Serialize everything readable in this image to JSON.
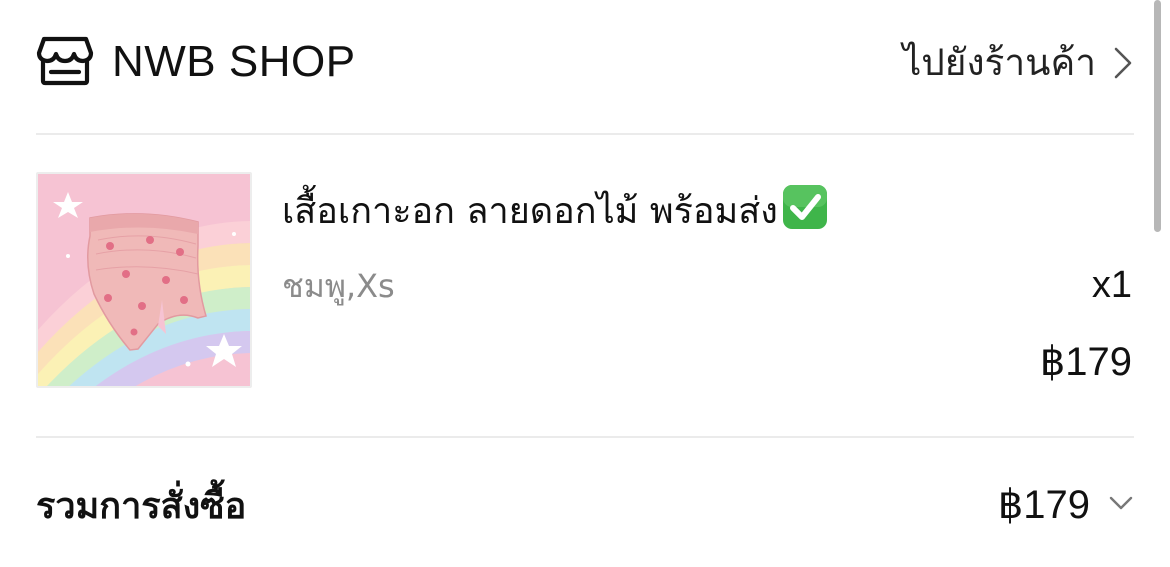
{
  "shop": {
    "name": "NWB SHOP",
    "go_to_store_label": "ไปยังร้านค้า",
    "icon": "store-icon"
  },
  "product": {
    "name": "เสื้อเกาะอก ลายดอกไม้ พร้อมส่ง",
    "name_badge": "check-mark-button-icon",
    "variant": "ชมพู,Xs",
    "quantity": "x1",
    "price": "฿179",
    "thumbnail": "pink-floral-tube-top-on-rainbow-background"
  },
  "order_total": {
    "label": "รวมการสั่งซื้อ",
    "value": "฿179",
    "expand_icon": "chevron-down-icon"
  },
  "colors": {
    "text_primary": "#111111",
    "text_secondary": "#8b8b8b",
    "divider": "#ebebeb",
    "check_badge": "#3fb54a",
    "thumbnail_bg": "#f7c6d6"
  }
}
